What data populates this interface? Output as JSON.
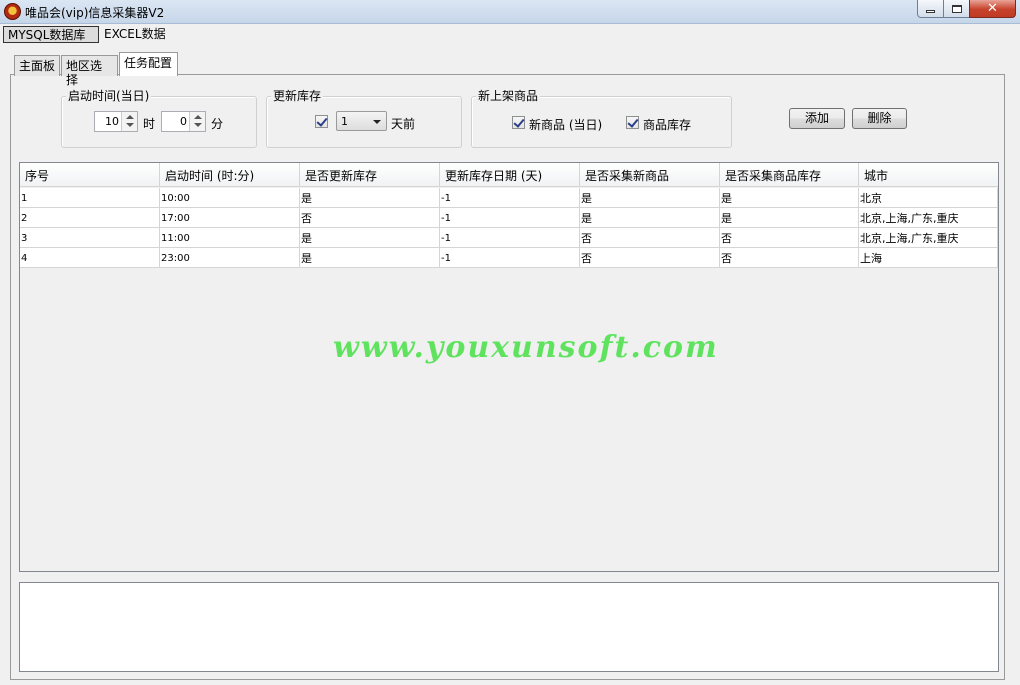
{
  "window": {
    "title": "唯品会(vip)信息采集器V2",
    "close_label": "✕"
  },
  "menu": {
    "items": [
      "MYSQL数据库",
      "EXCEL数据"
    ]
  },
  "tabs": [
    "主面板",
    "地区选择",
    "任务配置"
  ],
  "active_tab": "任务配置",
  "start_time_group": {
    "title": "启动时间(当日)",
    "hour_value": "10",
    "hour_label": "时",
    "minute_value": "0",
    "minute_label": "分"
  },
  "update_stock_group": {
    "title": "更新库存",
    "checked": true,
    "days_value": "1",
    "days_label": "天前"
  },
  "new_products_group": {
    "title": "新上架商品",
    "new_product_label": "新商品 (当日)",
    "new_product_checked": true,
    "stock_label": "商品库存",
    "stock_checked": true
  },
  "buttons": {
    "add": "添加",
    "delete": "删除"
  },
  "table": {
    "columns": [
      "序号",
      "启动时间 (时:分)",
      "是否更新库存",
      "更新库存日期 (天)",
      "是否采集新商品",
      "是否采集商品库存",
      "城市"
    ],
    "rows": [
      [
        "1",
        "10:00",
        "是",
        "-1",
        "是",
        "是",
        "北京"
      ],
      [
        "2",
        "17:00",
        "否",
        "-1",
        "是",
        "是",
        "北京,上海,广东,重庆"
      ],
      [
        "3",
        "11:00",
        "是",
        "-1",
        "否",
        "否",
        "北京,上海,广东,重庆"
      ],
      [
        "4",
        "23:00",
        "是",
        "-1",
        "否",
        "否",
        "上海"
      ]
    ]
  },
  "watermark": "www.youxunsoft.com",
  "log_text": ""
}
